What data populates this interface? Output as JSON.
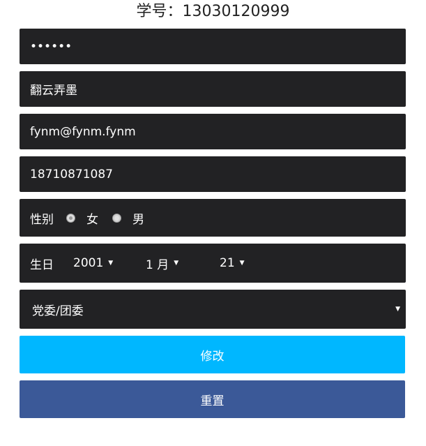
{
  "header": {
    "title": "学号：13030120999"
  },
  "form": {
    "password_value": "••••••",
    "nickname_value": "翻云弄墨",
    "email_value": "fynm@fynm.fynm",
    "phone_value": "18710871087",
    "gender": {
      "label": "性别",
      "options": [
        "女",
        "男"
      ],
      "selected": "女"
    },
    "birthday": {
      "label": "生日",
      "year": "2001",
      "month": "1 月",
      "day": "21"
    },
    "department": "党委/团委",
    "submit_label": "修改",
    "reset_label": "重置"
  },
  "icons": {
    "dropdown": "caret-down-icon",
    "radio": "radio-icon"
  },
  "colors": {
    "field_bg": "#222224",
    "submit": "#00b7ff",
    "reset": "#3b5998"
  }
}
